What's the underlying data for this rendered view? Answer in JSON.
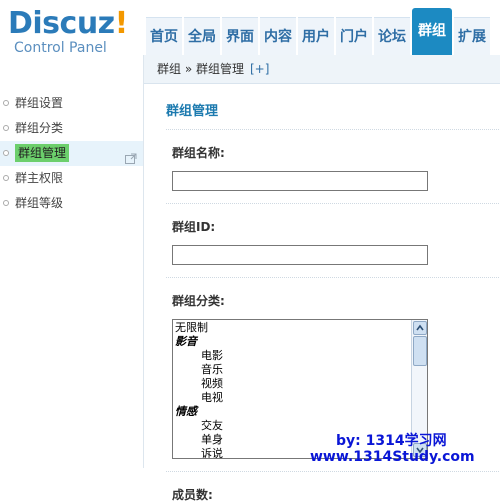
{
  "logo": {
    "brand": "Discuz",
    "bang": "!",
    "sub": "Control Panel"
  },
  "topnav": [
    "首页",
    "全局",
    "界面",
    "内容",
    "用户",
    "门户",
    "论坛",
    "群组",
    "扩展"
  ],
  "topnav_active_index": 7,
  "sidebar": {
    "items": [
      {
        "label": "群组设置"
      },
      {
        "label": "群组分类"
      },
      {
        "label": "群组管理",
        "active": true
      },
      {
        "label": "群主权限"
      },
      {
        "label": "群组等级"
      }
    ]
  },
  "breadcrumb": {
    "path": "群组 » 群组管理",
    "expand": "[+]"
  },
  "page": {
    "title": "群组管理",
    "name_label": "群组名称:",
    "name_value": "",
    "id_label": "群组ID:",
    "id_value": "",
    "category_label": "群组分类:",
    "members_label": "成员数:"
  },
  "categories": [
    {
      "label": "无限制",
      "type": "root"
    },
    {
      "label": "影音",
      "type": "group"
    },
    {
      "label": "电影",
      "type": "child"
    },
    {
      "label": "音乐",
      "type": "child"
    },
    {
      "label": "视频",
      "type": "child"
    },
    {
      "label": "电视",
      "type": "child"
    },
    {
      "label": "情感",
      "type": "group"
    },
    {
      "label": "交友",
      "type": "child"
    },
    {
      "label": "单身",
      "type": "child"
    },
    {
      "label": "诉说",
      "type": "child"
    }
  ],
  "watermark": {
    "line1": "by: 1314学习网",
    "line2": "www.1314Study.com"
  },
  "colors": {
    "accent": "#1c8ac2",
    "active_side": "#6ccf6c",
    "title": "#1c7aaf"
  }
}
